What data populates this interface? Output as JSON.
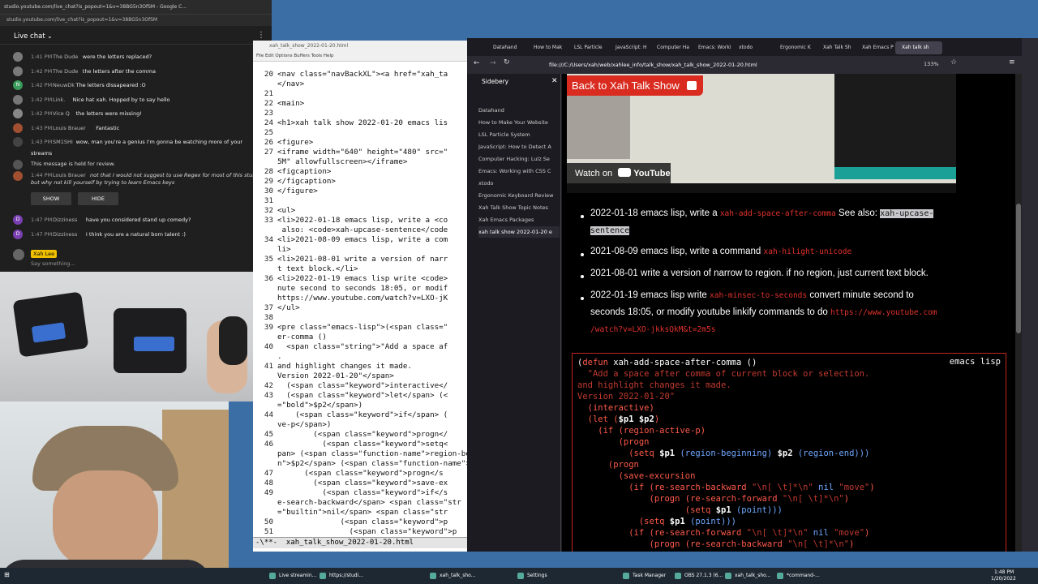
{
  "chat": {
    "window_title": "studio.youtube.com/live_chat?is_popout=1&v=38BG5n3OfSM - Google C...",
    "url": "studio.youtube.com/live_chat?is_popout=1&v=38BG5n3OfSM",
    "header": "Live chat",
    "messages": [
      {
        "initial": "",
        "time": "1:41 PM",
        "name": "The Dude",
        "text": "were the letters replaced?",
        "color": "#7a7a7a"
      },
      {
        "initial": "",
        "time": "1:42 PM",
        "name": "The Dude",
        "text": "the letters after the comma",
        "color": "#7a7a7a"
      },
      {
        "initial": "N",
        "time": "1:42 PM",
        "name": "NeuwDk",
        "text": "The letters dissapeared :O",
        "color": "#3a9a5a"
      },
      {
        "initial": "",
        "time": "1:42 PM",
        "name": "Link.",
        "text": "Nice hat xah. Hopped by to say hello",
        "color": "#777"
      },
      {
        "initial": "",
        "time": "1:42 PM",
        "name": "Vice Q",
        "text": "the letters were missing!",
        "color": "#888"
      },
      {
        "initial": "",
        "time": "1:43 PM",
        "name": "Louis Brauer",
        "text": "Fantastic",
        "color": "#a05030"
      },
      {
        "initial": "",
        "time": "1:43 PM",
        "name": "SM1SHI",
        "text": "wow, man you're a genius I'm gonna be watching more of your",
        "color": "#444"
      }
    ],
    "msg_cont": "streams",
    "held": {
      "notice": "This message is held for review.",
      "time": "1:44 PM",
      "name": "Louis Brauer",
      "text": "not that I would not suggest to use Regex for most of this stuff,",
      "text2": "but why not kill yourself by trying to learn Emacs keys",
      "show": "SHOW",
      "hide": "HIDE"
    },
    "later_messages": [
      {
        "initial": "D",
        "time": "1:47 PM",
        "name": "Dizziness",
        "text": "have you considered stand up comedy?",
        "color": "#7a3fb0"
      },
      {
        "initial": "D",
        "time": "1:47 PM",
        "name": "Dizziness",
        "text": "I think you are a natural born talent :)",
        "color": "#7a3fb0"
      }
    ],
    "own_badge": "Xah Lee",
    "input_placeholder": "Say something..."
  },
  "emacs": {
    "title": "xah_talk_show_2022-01-20.html",
    "menu": "File   Edit   Options   Buffers   Tools   Help",
    "lines": [
      {
        "n": "20",
        "t": "<nav class=\"navBackXL\"><a href=\"xah_ta"
      },
      {
        "n": "",
        "t": "</nav>"
      },
      {
        "n": "21",
        "t": ""
      },
      {
        "n": "22",
        "t": "<main>"
      },
      {
        "n": "23",
        "t": ""
      },
      {
        "n": "24",
        "t": "<h1>xah talk show 2022-01-20 emacs lis"
      },
      {
        "n": "25",
        "t": ""
      },
      {
        "n": "26",
        "t": "<figure>"
      },
      {
        "n": "27",
        "t": "<iframe width=\"640\" height=\"480\" src=\""
      },
      {
        "n": "",
        "t": "5M\" allowfullscreen></iframe>"
      },
      {
        "n": "28",
        "t": "<figcaption>"
      },
      {
        "n": "29",
        "t": "</figcaption>"
      },
      {
        "n": "30",
        "t": "</figure>"
      },
      {
        "n": "31",
        "t": ""
      },
      {
        "n": "32",
        "t": "<ul>"
      },
      {
        "n": "33",
        "t": "<li>2022-01-18 emacs lisp, write a <co"
      },
      {
        "n": "",
        "t": " also: <code>xah-upcase-sentence</code"
      },
      {
        "n": "34",
        "t": "<li>2021-08-09 emacs lisp, write a com"
      },
      {
        "n": "",
        "t": "li>"
      },
      {
        "n": "35",
        "t": "<li>2021-08-01 write a version of narr"
      },
      {
        "n": "",
        "t": "t text block.</li>"
      },
      {
        "n": "36",
        "t": "<li>2022-01-19 emacs lisp write <code>"
      },
      {
        "n": "",
        "t": "nute second to seconds 18:05, or modif"
      },
      {
        "n": "",
        "t": "https://www.youtube.com/watch?v=LXO-jK"
      },
      {
        "n": "37",
        "t": "</ul>"
      },
      {
        "n": "38",
        "t": ""
      },
      {
        "n": "39",
        "t": "<pre class=\"emacs-lisp\">(<span class=\""
      },
      {
        "n": "",
        "t": "er-comma ()"
      },
      {
        "n": "40",
        "t": "  <span class=\"string\">\"Add a space af"
      },
      {
        "n": "",
        "t": "."
      },
      {
        "n": "41",
        "t": "and highlight changes it made."
      },
      {
        "n": "",
        "t": "Version 2022-01-20\"</span>"
      },
      {
        "n": "42",
        "t": "  (<span class=\"keyword\">interactive</"
      },
      {
        "n": "43",
        "t": "  (<span class=\"keyword\">let</span> (<"
      },
      {
        "n": "",
        "t": "=\"bold\">$p2</span>)"
      },
      {
        "n": "44",
        "t": "    (<span class=\"keyword\">if</span> ("
      },
      {
        "n": "",
        "t": "ve-p</span>)"
      },
      {
        "n": "45",
        "t": "        (<span class=\"keyword\">progn</"
      },
      {
        "n": "46",
        "t": "          (<span class=\"keyword\">setq<"
      },
      {
        "n": "",
        "t": "pan> (<span class=\"function-name\">region-begi"
      },
      {
        "n": "",
        "t": "n\">$p2</span> (<span class=\"function-name\">region-end</"
      },
      {
        "n": "47",
        "t": "      (<span class=\"keyword\">progn</s"
      },
      {
        "n": "48",
        "t": "        (<span class=\"keyword\">save-ex"
      },
      {
        "n": "49",
        "t": "          (<span class=\"keyword\">if</s"
      },
      {
        "n": "",
        "t": "e-search-backward</span> <span class=\"str"
      },
      {
        "n": "",
        "t": "=\"builtin\">nil</span> <span class=\"str"
      },
      {
        "n": "50",
        "t": "              (<span class=\"keyword\">p"
      },
      {
        "n": "51",
        "t": "                (<span class=\"keyword\">p"
      }
    ],
    "modeline": "-\\**-  xah_talk_show_2022-01-20.html"
  },
  "browser": {
    "tabs": [
      "Datahand",
      "How to Mak",
      "LSL Particle",
      "JavaScript: H",
      "Computer Ha",
      "Emacs: Worki",
      "xtodo",
      "Ergonomic K",
      "Xah Talk Sh",
      "Xah Emacs P",
      "Xah talk sh"
    ],
    "url": "file:///C:/Users/xah/web/xahlee_info/talk_show/xah_talk_show_2022-01-20.html",
    "zoom": "133%",
    "sidebar_title": "Sidebery",
    "sidebar_items": [
      "Datahand",
      "How to Make Your Website",
      "LSL Particle System",
      "JavaScript: How to Detect A",
      "Computer Hacking: Lulz Se",
      "Emacs: Working with CSS C",
      "xtodo",
      "Ergonomic Keyboard Review",
      "Xah Talk Show Topic Notes",
      "Xah Emacs Packages",
      "xah talk show 2022-01-20 e"
    ],
    "back_button": "Back to Xah Talk Show",
    "watch_on": "Watch on",
    "youtube": "YouTube",
    "list": [
      {
        "pre": "2022-01-18 emacs lisp, write a ",
        "code": "xah-add-space-after-comma",
        "mid": " See also: ",
        "hl": "xah-upcase-",
        "hl2": "sentence"
      },
      {
        "pre": "2021-08-09 emacs lisp, write a command ",
        "code": "xah-hilight-unicode"
      },
      {
        "pre": "2021-08-01 write a version of narrow to region. if no region, just current text block."
      },
      {
        "pre": "2022-01-19 emacs lisp write ",
        "code": "xah-minsec-to-seconds",
        "mid": " convert minute second to",
        "line2": "seconds 18:05, or modify youtube linkify commands to do ",
        "url1": "https://www.youtube.com",
        "url2": "/watch?v=LXO-jkksQkM&t=2m5s"
      }
    ],
    "code_lang": "emacs lisp",
    "code": {
      "l1_paren": "(",
      "l1_kw": "defun",
      "l1_name": " xah-add-space-after-comma ()",
      "l2": "  \"Add a space after comma of current block or selection.",
      "l3": "and highlight changes it made.",
      "l4": "Version 2022-01-20\"",
      "l5": "  (interactive)",
      "l6a": "  (let (",
      "l6b": "$p1 $p2",
      "l6c": ")",
      "l7": "    (if (region-active-p)",
      "l8": "        (progn",
      "l9a": "          (setq ",
      "l9b": "$p1",
      "l9c": " (region-beginning) ",
      "l9d": "$p2",
      "l9e": " (region-end)))",
      "l10": "      (progn",
      "l11": "        (save-excursion",
      "l12a": "          (if (re-search-backward ",
      "l12b": "\"\\n[ \\t]*\\n\"",
      "l12c": " nil ",
      "l12d": "\"move\"",
      "l12e": ")",
      "l13a": "              (progn (re-search-forward ",
      "l13b": "\"\\n[ \\t]*\\n\"",
      "l13c": ")",
      "l14a": "                     (setq ",
      "l14b": "$p1",
      "l14c": " (point)))",
      "l15a": "            (setq ",
      "l15b": "$p1",
      "l15c": " (point)))",
      "l16a": "          (if (re-search-forward ",
      "l16b": "\"\\n[ \\t]*\\n\"",
      "l16c": " nil ",
      "l16d": "\"move\"",
      "l16e": ")",
      "l17a": "              (progn (re-search-backward ",
      "l17b": "\"\\n[ \\t]*\\n\"",
      "l17c": ")"
    }
  },
  "taskbar": {
    "items": [
      "Live streamin...",
      "https://studi...",
      "xah_talk_sho...",
      "Settings",
      "Task Manager",
      "OBS 27.1.3 (6...",
      "xah_talk_sho...",
      "*command-..."
    ],
    "time": "1:48 PM",
    "date": "1/20/2022"
  },
  "colors": {
    "accent_red": "#d92b1f",
    "code_red": "#e0322c",
    "link_blue": "#6fa8ff"
  }
}
